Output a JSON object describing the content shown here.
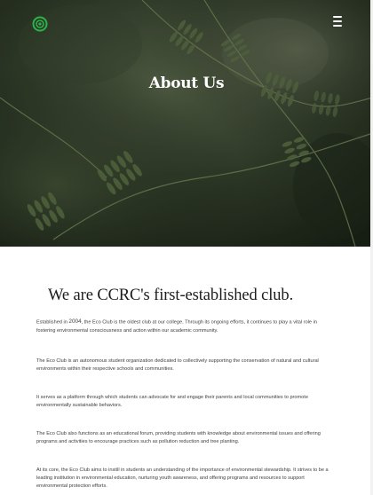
{
  "header": {
    "logo_icon": "eco-leaf-logo-icon",
    "menu_icon": "hamburger-menu-icon",
    "accent_color": "#2bb34a"
  },
  "hero": {
    "title": "About Us",
    "background": "fern-leaves-photo"
  },
  "about": {
    "heading": "We are CCRC's first-established club.",
    "paragraphs": [
      {
        "before_year": "Established in ",
        "year": "2004",
        "after_year": ", the Eco Club is the oldest club at our college. Through its ongoing efforts, it continues to play a vital role in fostering environmental consciousness and action within our academic community."
      },
      {
        "text": "The Eco Club is an autonomous student organization dedicated to collectively supporting the conservation of natural and cultural environments within their respective schools and communities."
      },
      {
        "text": "It serves as a platform through which students can advocate for and engage their parents and local communities to promote environmentally sustainable behaviors."
      },
      {
        "text": "The Eco Club also functions as an educational forum, providing students with knowledge about environmental issues and offering programs and activities to encourage practices such as pollution reduction and tree planting."
      },
      {
        "text": "At its core, the Eco Club aims to instill in students an understanding of the importance of environmental stewardship. It strives to be a leading institution in environmental education, nurturing youth awareness, and offering programs and resources to support environmental protection efforts."
      }
    ]
  }
}
